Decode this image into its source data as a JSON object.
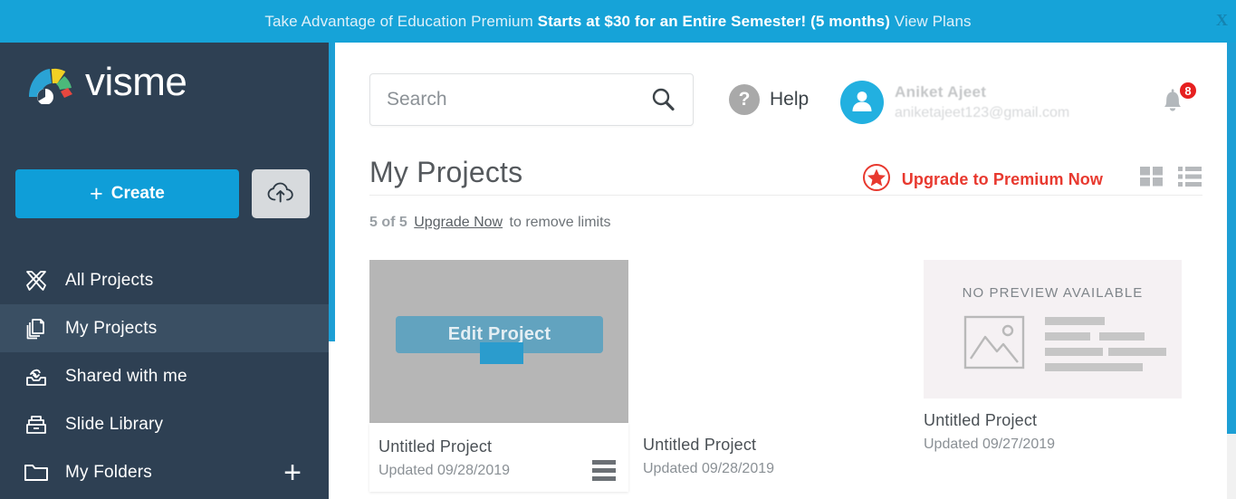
{
  "banner": {
    "lead_text": "Take Advantage of Education Premium ",
    "bold_text": "Starts at $30 for an Entire Semester! (5 months)",
    "link_text": " View Plans",
    "close_label": "X",
    "bg_color": "#16a3d8"
  },
  "sidebar": {
    "logo_text": "visme",
    "create_label": "Create",
    "create_plus": "+",
    "upload_icon": "cloud-upload-icon",
    "add_folder_label": "+",
    "items": [
      {
        "label": "All Projects",
        "icon": "crossed-pencils-icon",
        "active": false
      },
      {
        "label": "My Projects",
        "icon": "copy-documents-icon",
        "active": true
      },
      {
        "label": "Shared with me",
        "icon": "shared-inbox-icon",
        "active": false
      },
      {
        "label": "Slide Library",
        "icon": "library-tray-icon",
        "active": false
      },
      {
        "label": "My Folders",
        "icon": "folder-icon",
        "active": false
      }
    ]
  },
  "header": {
    "search_placeholder": "Search",
    "search_value": "",
    "search_icon": "magnifier-icon",
    "help_label": "Help",
    "help_icon": "question-mark-icon",
    "avatar_icon": "user-avatar-icon",
    "user_name": "Aniket Ajeet",
    "user_email": "aniketajeet123@gmail.com",
    "bell_icon": "notification-bell-icon",
    "notification_count": "8"
  },
  "main": {
    "page_title": "My Projects",
    "upgrade_label": "Upgrade to Premium Now",
    "upgrade_icon": "red-star-icon",
    "upgrade_color": "#e8392f",
    "grid_view_icon": "grid-view-icon",
    "list_view_icon": "list-view-icon",
    "limit_count": "5 of 5",
    "limit_link": "Upgrade Now",
    "limit_suffix": "to remove limits",
    "edit_overlay_label": "Edit Project",
    "no_preview_label": "NO PREVIEW AVAILABLE",
    "projects": [
      {
        "name": "Untitled Project",
        "updated": "Updated 09/28/2019",
        "preview": "gray-hover"
      },
      {
        "name": "Untitled Project",
        "updated": "Updated 09/28/2019",
        "preview": "blank"
      },
      {
        "name": "Untitled Project",
        "updated": "Updated 09/27/2019",
        "preview": "no-preview"
      }
    ]
  }
}
